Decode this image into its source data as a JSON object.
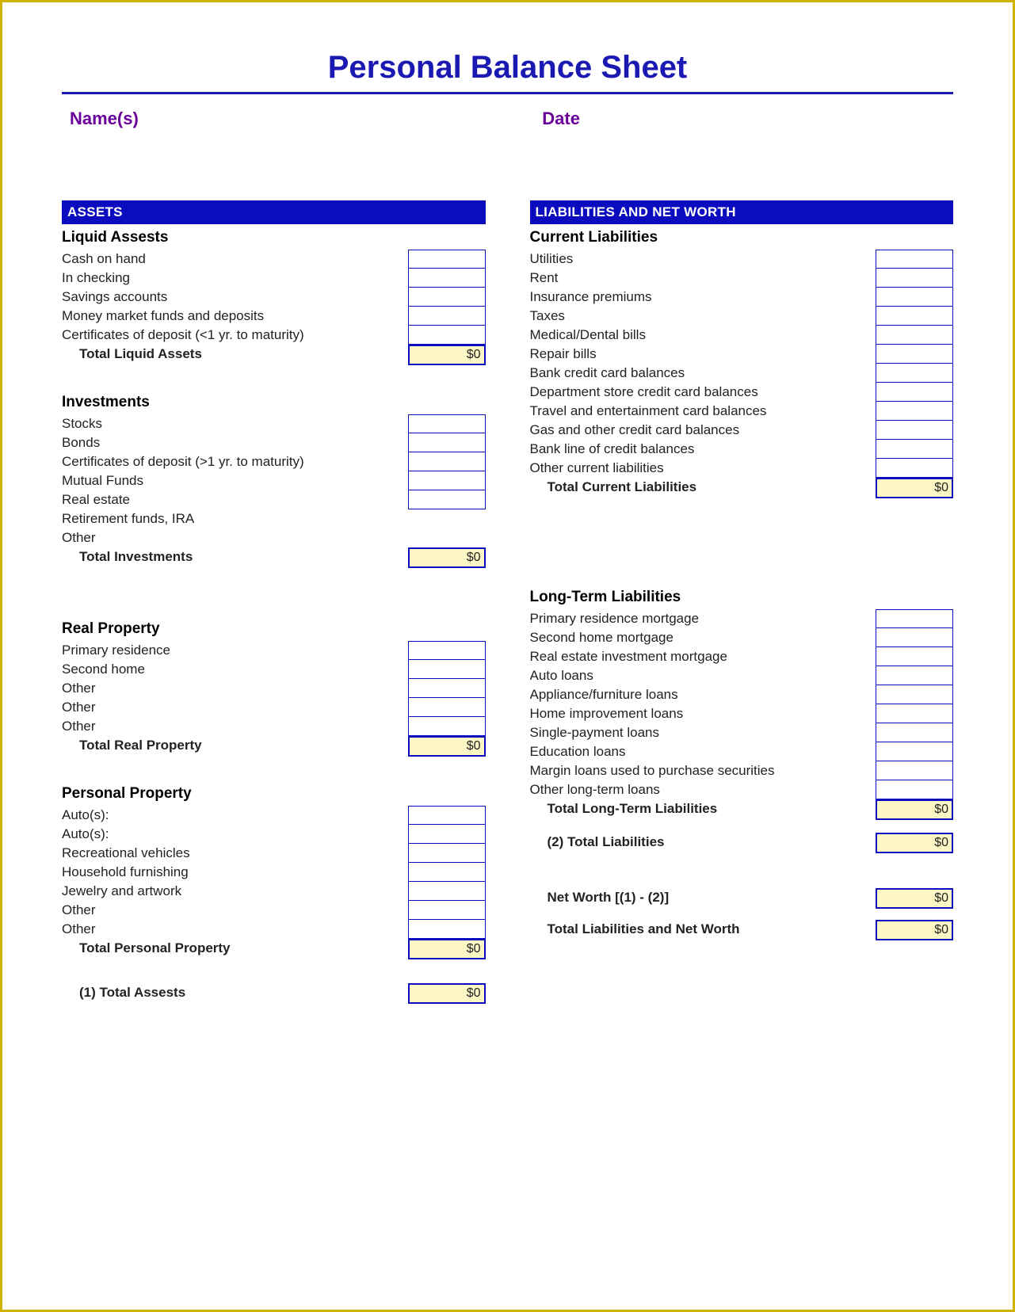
{
  "title": "Personal Balance Sheet",
  "header": {
    "names_label": "Name(s)",
    "date_label": "Date"
  },
  "assets": {
    "band": "ASSETS",
    "liquid": {
      "heading": "Liquid Assests",
      "items": [
        "Cash on hand",
        "In checking",
        "Savings accounts",
        "Money market funds and deposits",
        "Certificates of deposit (<1 yr. to maturity)"
      ],
      "total_label": "Total Liquid Assets",
      "total_value": "$0"
    },
    "investments": {
      "heading": "Investments",
      "items": [
        "Stocks",
        "Bonds",
        "Certificates of deposit (>1 yr. to maturity)",
        "Mutual Funds",
        "Real estate",
        "Retirement funds, IRA",
        "Other"
      ],
      "total_label": "Total Investments",
      "total_value": "$0"
    },
    "real_property": {
      "heading": "Real Property",
      "items": [
        "Primary residence",
        "Second home",
        "Other",
        "Other",
        "Other"
      ],
      "total_label": "Total Real Property",
      "total_value": "$0"
    },
    "personal_property": {
      "heading": "Personal Property",
      "items": [
        "Auto(s):",
        "Auto(s):",
        "Recreational vehicles",
        "Household furnishing",
        "Jewelry and artwork",
        "Other",
        "Other"
      ],
      "total_label": "Total Personal Property",
      "total_value": "$0"
    },
    "total_label": "(1) Total Assests",
    "total_value": "$0"
  },
  "liabilities": {
    "band": "LIABILITIES AND NET WORTH",
    "current": {
      "heading": "Current Liabilities",
      "items": [
        "Utilities",
        "Rent",
        "Insurance premiums",
        "Taxes",
        "Medical/Dental bills",
        "Repair bills",
        "Bank credit card balances",
        "Department store credit card balances",
        "Travel and entertainment card balances",
        "Gas and other credit card balances",
        "Bank line of credit balances",
        "Other current liabilities"
      ],
      "total_label": "Total Current Liabilities",
      "total_value": "$0"
    },
    "long_term": {
      "heading": "Long-Term Liabilities",
      "items": [
        "Primary residence mortgage",
        "Second home mortgage",
        "Real estate investment mortgage",
        "Auto loans",
        "Appliance/furniture loans",
        "Home improvement loans",
        "Single-payment loans",
        "Education loans",
        "Margin loans used to purchase securities",
        "Other long-term loans"
      ],
      "total_label": "Total Long-Term Liabilities",
      "total_value": "$0"
    },
    "total_liabilities_label": "(2) Total Liabilities",
    "total_liabilities_value": "$0",
    "net_worth_label": "Net Worth [(1) - (2)]",
    "net_worth_value": "$0",
    "grand_total_label": "Total Liabilities and Net Worth",
    "grand_total_value": "$0"
  }
}
